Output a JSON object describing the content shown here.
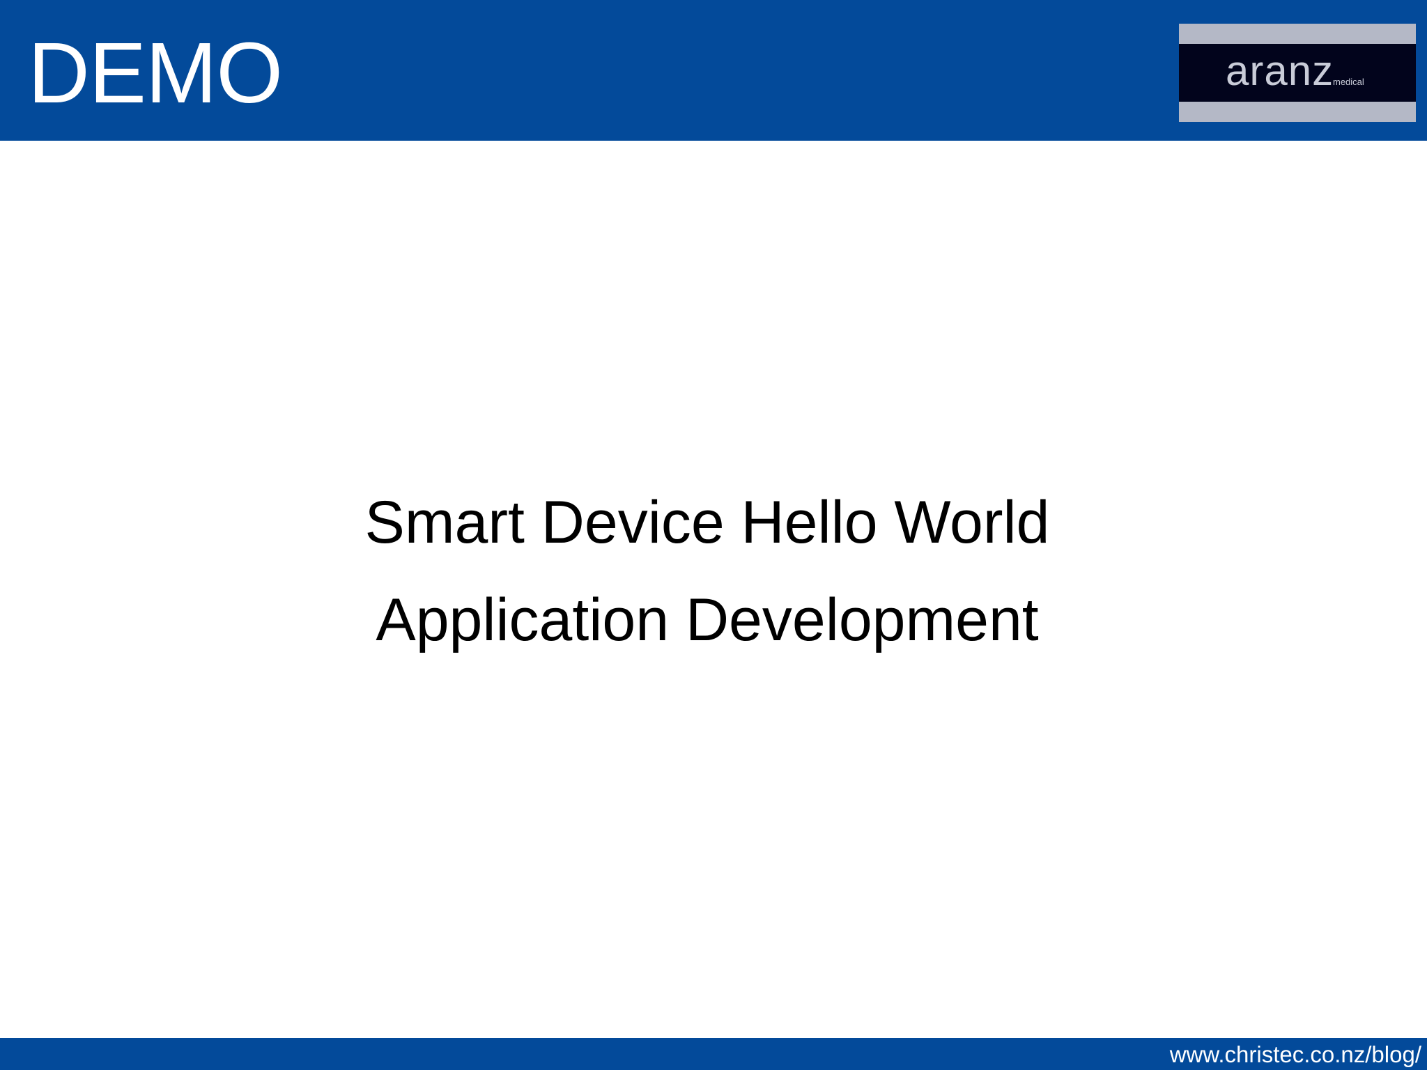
{
  "header": {
    "title": "DEMO"
  },
  "logo": {
    "wordmark": "aranz",
    "subtext": "medical"
  },
  "body": {
    "lines": [
      "Smart Device Hello World",
      "Application Development"
    ]
  },
  "footer": {
    "url": "www.christec.co.nz/blog/"
  },
  "colors": {
    "header_bar": "#034A9A",
    "footer_bar": "#034A9A",
    "logo_background": "#02041c",
    "logo_frame": "#b4b8c6"
  }
}
